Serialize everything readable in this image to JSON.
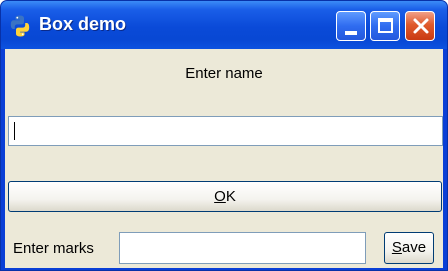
{
  "window": {
    "title": "Box demo",
    "icon": "python-icon",
    "controls": {
      "minimize": "minimize-icon",
      "maximize": "maximize-icon",
      "close": "close-icon"
    }
  },
  "form": {
    "name_label": "Enter name",
    "name_value": "",
    "ok_button": {
      "mnemonic": "O",
      "rest": "K"
    },
    "marks_label": "Enter marks",
    "marks_value": "",
    "save_button": {
      "mnemonic": "S",
      "rest": "ave"
    }
  },
  "colors": {
    "titlebar": "#0a4ad8",
    "client_bg": "#ece9d8",
    "close_button": "#e05a2c",
    "input_border": "#7f9db9",
    "button_border": "#003c74"
  }
}
